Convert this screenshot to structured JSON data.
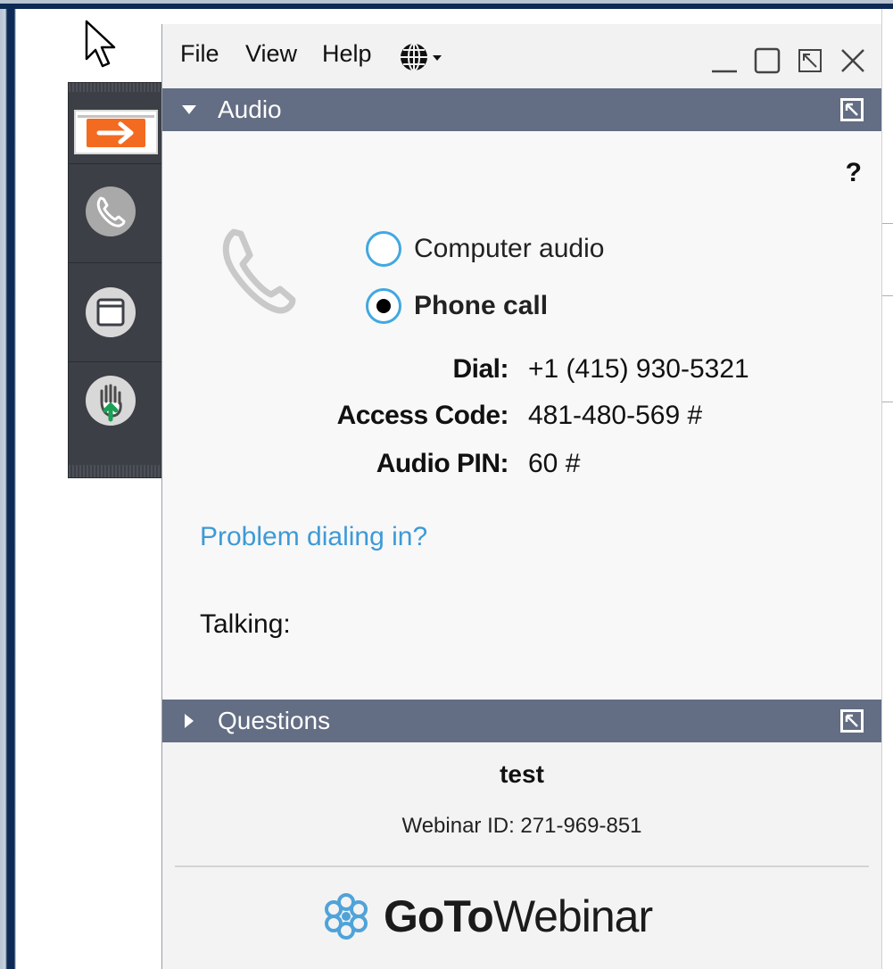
{
  "menubar": {
    "file": "File",
    "view": "View",
    "help": "Help",
    "language_icon": "globe-icon"
  },
  "window_controls": [
    "minimize",
    "maximize",
    "restore",
    "close"
  ],
  "side_panel": {
    "buttons": [
      "collapse-arrow",
      "audio",
      "screen",
      "raise-hand"
    ]
  },
  "audio": {
    "header": "Audio",
    "help": "?",
    "options": [
      {
        "label": "Computer audio",
        "selected": false
      },
      {
        "label": "Phone call",
        "selected": true
      }
    ],
    "dial_label": "Dial:",
    "dial_value": "+1 (415) 930-5321",
    "access_label": "Access Code:",
    "access_value": "481-480-569 #",
    "pin_label": "Audio PIN:",
    "pin_value": "60 #",
    "problem_link": "Problem dialing in?",
    "talking_label": "Talking:"
  },
  "questions": {
    "header": "Questions"
  },
  "footer": {
    "webinar_title": "test",
    "webinar_id": "Webinar ID: 271-969-851",
    "brand_goto": "GoTo",
    "brand_webinar": "Webinar"
  },
  "colors": {
    "accent_orange": "#f26b21",
    "header_bg": "#636d83",
    "radio_ring": "#41a8e0",
    "link": "#3d9ad7",
    "brand_icon": "#4fa3d9"
  }
}
